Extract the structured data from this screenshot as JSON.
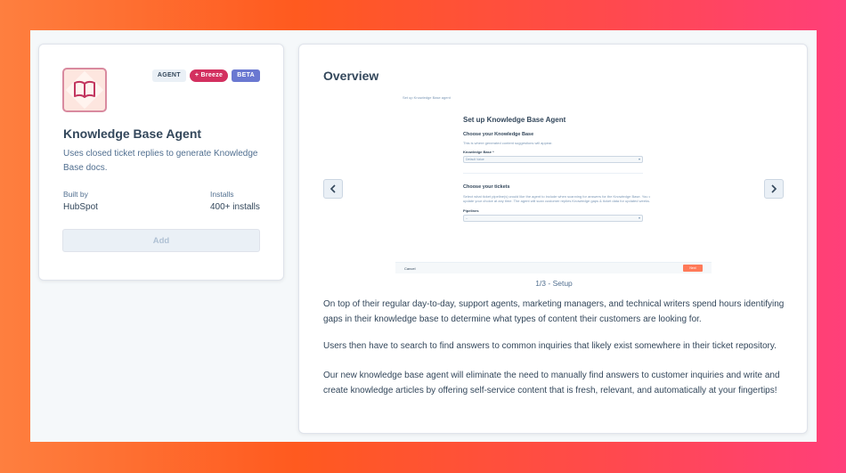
{
  "app": {
    "icon": "book-icon",
    "badges": {
      "agent": "AGENT",
      "breeze": "+ Breeze",
      "beta": "BETA"
    },
    "title": "Knowledge Base Agent",
    "description": "Uses closed ticket replies to generate Knowledge Base docs.",
    "built_by_label": "Built by",
    "built_by_value": "HubSpot",
    "installs_label": "Installs",
    "installs_value": "400+ installs",
    "add_label": "Add"
  },
  "overview": {
    "title": "Overview",
    "preview": {
      "breadcrumb": "Set up Knowledge Base agent",
      "heading": "Set up Knowledge Base Agent",
      "section1_title": "Choose your Knowledge Base",
      "section1_sub": "This is where generated content suggestions will appear.",
      "kb_label": "Knowledge Base *",
      "kb_value": "Default Value",
      "section2_title": "Choose your tickets",
      "section2_sub_1": "Select what ticket pipeline(s) would like the agent to include when scanning for answers for the Knowledge Base. You can",
      "section2_sub_2": "update your choice at any time. The agent will scan customer replies Knowledge gaps & ticket data for updated weeks.",
      "pipeline_label": "Pipelines",
      "pipeline_value": "--",
      "cancel_label": "Cancel",
      "next_label": "Next"
    },
    "caption": "1/3 - Setup",
    "paragraphs": [
      "On top of their regular day-to-day, support agents, marketing managers, and technical writers spend hours identifying gaps in their knowledge base to determine what types of content their customers are looking for.",
      "Users then have to search to find answers to common inquiries that likely exist somewhere in their ticket repository.",
      "Our new knowledge base agent will eliminate the need to manually find answers to customer inquiries and write and create knowledge articles by offering self-service content that is fresh, relevant, and automatically at your fingertips!"
    ],
    "prev_icon": "chevron-left-icon",
    "next_icon": "chevron-right-icon"
  },
  "colors": {
    "accent": "#ff7a59",
    "breeze": "#d3305f",
    "beta": "#6a78d1",
    "text": "#33475b"
  }
}
